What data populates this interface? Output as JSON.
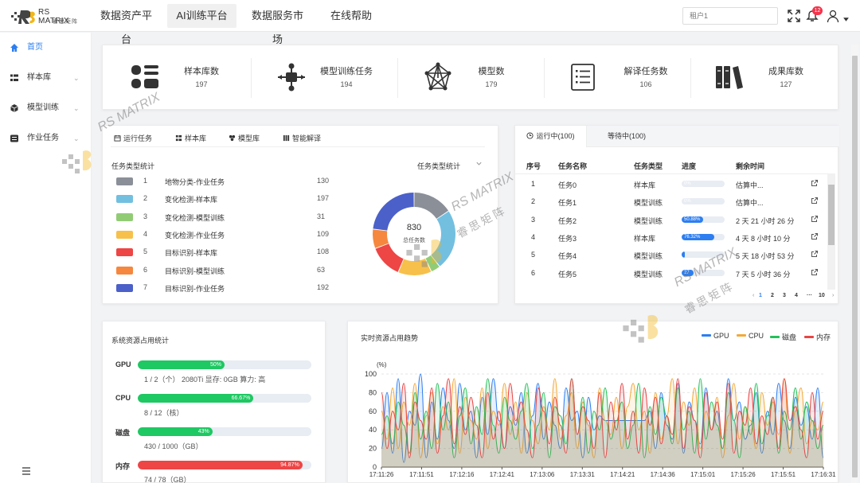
{
  "app": {
    "logo_text": "RS MATRIX",
    "logo_sub": "睿思矩阵"
  },
  "nav": [
    {
      "label": "数据资产平台",
      "active": false
    },
    {
      "label": "AI训练平台",
      "active": true
    },
    {
      "label": "数据服务市场",
      "active": false
    },
    {
      "label": "在线帮助",
      "active": false
    }
  ],
  "header": {
    "tenant_placeholder": "租户1",
    "notification_count": "12"
  },
  "sidebar": {
    "items": [
      {
        "label": "首页",
        "icon": "home-icon",
        "active": true,
        "chevron": ""
      },
      {
        "label": "样本库",
        "icon": "grid-icon",
        "active": false,
        "chevron": "⌄"
      },
      {
        "label": "模型训练",
        "icon": "cube-icon",
        "active": false,
        "chevron": "⌄"
      },
      {
        "label": "作业任务",
        "icon": "task-icon",
        "active": false,
        "chevron": "⌄"
      }
    ]
  },
  "stats": [
    {
      "label": "样本库数",
      "value": "197",
      "icon": "sample-library-icon"
    },
    {
      "label": "模型训练任务",
      "value": "194",
      "icon": "workflow-icon"
    },
    {
      "label": "模型数",
      "value": "179",
      "icon": "network-icon"
    },
    {
      "label": "解译任务数",
      "value": "106",
      "icon": "list-icon"
    },
    {
      "label": "成果库数",
      "value": "127",
      "icon": "books-icon"
    }
  ],
  "task_panel": {
    "tabs": [
      "运行任务",
      "样本库",
      "模型库",
      "智能解译"
    ],
    "title": "任务类型统计",
    "select_value": "任务类型统计",
    "rows": [
      {
        "index": "1",
        "name": "地物分类-作业任务",
        "count": "130",
        "color": "#8a8f98"
      },
      {
        "index": "2",
        "name": "变化检测-样本库",
        "count": "197",
        "color": "#73bfe0"
      },
      {
        "index": "3",
        "name": "变化检测-模型训练",
        "count": "31",
        "color": "#91cc75"
      },
      {
        "index": "4",
        "name": "变化检测-作业任务",
        "count": "109",
        "color": "#f7c04a"
      },
      {
        "index": "5",
        "name": "目标识别-样本库",
        "count": "108",
        "color": "#ee4545"
      },
      {
        "index": "6",
        "name": "目标识别-模型训练",
        "count": "63",
        "color": "#f5883e"
      },
      {
        "index": "7",
        "name": "目标识别-作业任务",
        "count": "192",
        "color": "#4b60c8"
      }
    ],
    "donut_total": "830",
    "donut_label": "总任务数"
  },
  "run_panel": {
    "tabs": [
      "运行中(100)",
      "等待中(100)"
    ],
    "columns": [
      "序号",
      "任务名称",
      "任务类型",
      "进度",
      "剩余时间"
    ],
    "rows": [
      {
        "no": "1",
        "name": "任务0",
        "type": "样本库",
        "progress": 0.0,
        "progress_label": "0%",
        "remaining": "估算中..."
      },
      {
        "no": "2",
        "name": "任务1",
        "type": "模型训练",
        "progress": 0.0,
        "progress_label": "0%",
        "remaining": "估算中..."
      },
      {
        "no": "3",
        "name": "任务2",
        "type": "模型训练",
        "progress": 0.5088,
        "progress_label": "50.88%",
        "remaining": "2 天 21 小时 26 分"
      },
      {
        "no": "4",
        "name": "任务3",
        "type": "样本库",
        "progress": 0.7632,
        "progress_label": "76.32%",
        "remaining": "4 天 8 小时 10 分"
      },
      {
        "no": "5",
        "name": "任务4",
        "type": "模型训练",
        "progress": 0.02,
        "progress_label": "",
        "remaining": "5 天 18 小时 53 分"
      },
      {
        "no": "6",
        "name": "任务5",
        "type": "模型训练",
        "progress": 0.27,
        "progress_label": "27",
        "remaining": "7 天 5 小时 36 分"
      }
    ],
    "pages": [
      "1",
      "2",
      "3",
      "4",
      "···",
      "10"
    ]
  },
  "resource": {
    "title": "系统资源占用统计",
    "items": [
      {
        "name": "GPU",
        "percent": 0.5,
        "percent_label": "50%",
        "detail": "1 / 2（个）  2080Ti    显存: 0GB    算力: 高",
        "color": "#1ec862"
      },
      {
        "name": "CPU",
        "percent": 0.6667,
        "percent_label": "66.67%",
        "detail": "8 / 12（核）",
        "color": "#1ec862"
      },
      {
        "name": "磁盘",
        "percent": 0.43,
        "percent_label": "43%",
        "detail": "430 / 1000（GB）",
        "color": "#1ec862"
      },
      {
        "name": "内存",
        "percent": 0.9487,
        "percent_label": "94.87%",
        "detail": "74 / 78（GB）",
        "color": "#ee4545"
      }
    ]
  },
  "trend": {
    "title": "实时资源占用趋势",
    "legend": [
      {
        "name": "GPU",
        "color": "#2d7ef0"
      },
      {
        "name": "CPU",
        "color": "#f2a93b"
      },
      {
        "name": "磁盘",
        "color": "#25c05a"
      },
      {
        "name": "内存",
        "color": "#e84545"
      }
    ]
  },
  "chart_data": {
    "type": "area",
    "ylabel": "(%)",
    "ylim": [
      0,
      100
    ],
    "yticks": [
      0,
      20,
      40,
      60,
      80,
      100
    ],
    "x": [
      "17:11:26",
      "17:11:51",
      "17:12:16",
      "17:12:41",
      "17:13:06",
      "17:13:31",
      "17:14:21",
      "17:14:36",
      "17:15:01",
      "17:15:26",
      "17:15:51",
      "17:16:31"
    ],
    "series": [
      {
        "name": "GPU",
        "color": "#2d7ef0",
        "values": [
          20,
          80,
          15,
          95,
          5,
          60,
          45,
          100,
          10,
          70,
          30,
          85,
          50,
          20,
          90,
          40,
          60,
          10,
          75,
          35,
          95,
          50,
          20,
          65,
          45,
          80,
          15,
          55,
          90,
          30,
          70,
          45,
          20,
          85,
          50,
          60,
          10,
          75,
          40,
          55,
          50,
          50,
          50,
          50,
          50,
          50,
          50,
          50,
          60,
          20,
          80,
          45,
          30,
          90,
          15,
          70,
          50,
          25,
          85,
          40,
          60,
          20,
          95,
          50,
          70,
          30,
          45,
          80,
          15,
          60,
          35,
          90,
          50,
          20,
          75,
          45,
          65,
          30,
          85,
          10
        ]
      },
      {
        "name": "CPU",
        "color": "#f2a93b",
        "values": [
          60,
          30,
          85,
          20,
          70,
          45,
          90,
          10,
          55,
          80,
          25,
          65,
          40,
          95,
          15,
          75,
          50,
          30,
          85,
          20,
          60,
          45,
          90,
          35,
          70,
          15,
          80,
          50,
          25,
          65,
          40,
          95,
          30,
          55,
          80,
          20,
          70,
          45,
          10,
          85,
          50,
          35,
          75,
          20,
          65,
          90,
          40,
          60,
          15,
          80,
          30,
          55,
          95,
          25,
          70,
          45,
          85,
          20,
          60,
          40,
          75,
          10,
          55,
          90,
          30,
          65,
          50,
          20,
          80,
          45,
          70,
          35,
          95,
          15,
          60,
          85,
          25,
          50,
          40,
          70
        ]
      },
      {
        "name": "磁盘",
        "color": "#25c05a",
        "values": [
          35,
          55,
          25,
          70,
          45,
          15,
          80,
          30,
          60,
          20,
          90,
          40,
          70,
          10,
          55,
          85,
          25,
          65,
          35,
          95,
          45,
          15,
          75,
          50,
          30,
          60,
          90,
          20,
          45,
          80,
          10,
          65,
          55,
          25,
          95,
          35,
          75,
          15,
          60,
          40,
          85,
          30,
          50,
          70,
          20,
          45,
          90,
          10,
          65,
          35,
          75,
          55,
          25,
          85,
          40,
          60,
          15,
          95,
          30,
          70,
          45,
          20,
          80,
          50,
          10,
          65,
          35,
          90,
          25,
          55,
          75,
          15,
          60,
          40,
          85,
          30,
          70,
          50,
          20,
          45
        ]
      },
      {
        "name": "内存",
        "color": "#e84545",
        "values": [
          80,
          20,
          60,
          40,
          90,
          10,
          70,
          50,
          30,
          85,
          15,
          55,
          95,
          25,
          65,
          35,
          75,
          45,
          10,
          80,
          30,
          60,
          20,
          90,
          50,
          70,
          40,
          10,
          85,
          60,
          25,
          75,
          45,
          15,
          95,
          35,
          65,
          50,
          20,
          80,
          10,
          70,
          40,
          90,
          30,
          60,
          15,
          85,
          45,
          75,
          25,
          55,
          35,
          95,
          20,
          65,
          50,
          10,
          80,
          40,
          70,
          30,
          90,
          15,
          60,
          45,
          85,
          25,
          55,
          35,
          75,
          20,
          95,
          50,
          65,
          40,
          10,
          80,
          30,
          60
        ]
      }
    ]
  }
}
